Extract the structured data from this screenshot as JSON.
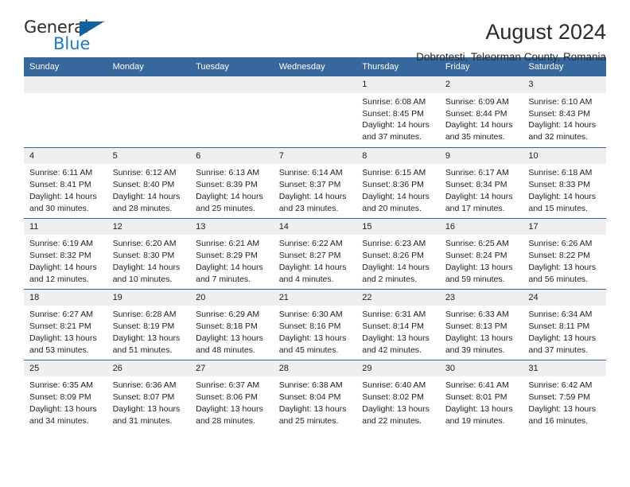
{
  "brand": {
    "name_part1": "General",
    "name_part2": "Blue",
    "triangle_color": "#12619f",
    "blue_color": "#1f7ac4"
  },
  "header": {
    "title": "August 2024",
    "subtitle": "Dobrotesti, Teleorman County, Romania"
  },
  "theme": {
    "header_bg": "#36689e",
    "daynum_bg": "#efefef",
    "text": "#222222"
  },
  "weekday_headers": [
    "Sunday",
    "Monday",
    "Tuesday",
    "Wednesday",
    "Thursday",
    "Friday",
    "Saturday"
  ],
  "weeks": [
    [
      {
        "day": "",
        "sunrise": "",
        "sunset": "",
        "daylight_line1": "",
        "daylight_line2": ""
      },
      {
        "day": "",
        "sunrise": "",
        "sunset": "",
        "daylight_line1": "",
        "daylight_line2": ""
      },
      {
        "day": "",
        "sunrise": "",
        "sunset": "",
        "daylight_line1": "",
        "daylight_line2": ""
      },
      {
        "day": "",
        "sunrise": "",
        "sunset": "",
        "daylight_line1": "",
        "daylight_line2": ""
      },
      {
        "day": "1",
        "sunrise": "Sunrise: 6:08 AM",
        "sunset": "Sunset: 8:45 PM",
        "daylight_line1": "Daylight: 14 hours",
        "daylight_line2": "and 37 minutes."
      },
      {
        "day": "2",
        "sunrise": "Sunrise: 6:09 AM",
        "sunset": "Sunset: 8:44 PM",
        "daylight_line1": "Daylight: 14 hours",
        "daylight_line2": "and 35 minutes."
      },
      {
        "day": "3",
        "sunrise": "Sunrise: 6:10 AM",
        "sunset": "Sunset: 8:43 PM",
        "daylight_line1": "Daylight: 14 hours",
        "daylight_line2": "and 32 minutes."
      }
    ],
    [
      {
        "day": "4",
        "sunrise": "Sunrise: 6:11 AM",
        "sunset": "Sunset: 8:41 PM",
        "daylight_line1": "Daylight: 14 hours",
        "daylight_line2": "and 30 minutes."
      },
      {
        "day": "5",
        "sunrise": "Sunrise: 6:12 AM",
        "sunset": "Sunset: 8:40 PM",
        "daylight_line1": "Daylight: 14 hours",
        "daylight_line2": "and 28 minutes."
      },
      {
        "day": "6",
        "sunrise": "Sunrise: 6:13 AM",
        "sunset": "Sunset: 8:39 PM",
        "daylight_line1": "Daylight: 14 hours",
        "daylight_line2": "and 25 minutes."
      },
      {
        "day": "7",
        "sunrise": "Sunrise: 6:14 AM",
        "sunset": "Sunset: 8:37 PM",
        "daylight_line1": "Daylight: 14 hours",
        "daylight_line2": "and 23 minutes."
      },
      {
        "day": "8",
        "sunrise": "Sunrise: 6:15 AM",
        "sunset": "Sunset: 8:36 PM",
        "daylight_line1": "Daylight: 14 hours",
        "daylight_line2": "and 20 minutes."
      },
      {
        "day": "9",
        "sunrise": "Sunrise: 6:17 AM",
        "sunset": "Sunset: 8:34 PM",
        "daylight_line1": "Daylight: 14 hours",
        "daylight_line2": "and 17 minutes."
      },
      {
        "day": "10",
        "sunrise": "Sunrise: 6:18 AM",
        "sunset": "Sunset: 8:33 PM",
        "daylight_line1": "Daylight: 14 hours",
        "daylight_line2": "and 15 minutes."
      }
    ],
    [
      {
        "day": "11",
        "sunrise": "Sunrise: 6:19 AM",
        "sunset": "Sunset: 8:32 PM",
        "daylight_line1": "Daylight: 14 hours",
        "daylight_line2": "and 12 minutes."
      },
      {
        "day": "12",
        "sunrise": "Sunrise: 6:20 AM",
        "sunset": "Sunset: 8:30 PM",
        "daylight_line1": "Daylight: 14 hours",
        "daylight_line2": "and 10 minutes."
      },
      {
        "day": "13",
        "sunrise": "Sunrise: 6:21 AM",
        "sunset": "Sunset: 8:29 PM",
        "daylight_line1": "Daylight: 14 hours",
        "daylight_line2": "and 7 minutes."
      },
      {
        "day": "14",
        "sunrise": "Sunrise: 6:22 AM",
        "sunset": "Sunset: 8:27 PM",
        "daylight_line1": "Daylight: 14 hours",
        "daylight_line2": "and 4 minutes."
      },
      {
        "day": "15",
        "sunrise": "Sunrise: 6:23 AM",
        "sunset": "Sunset: 8:26 PM",
        "daylight_line1": "Daylight: 14 hours",
        "daylight_line2": "and 2 minutes."
      },
      {
        "day": "16",
        "sunrise": "Sunrise: 6:25 AM",
        "sunset": "Sunset: 8:24 PM",
        "daylight_line1": "Daylight: 13 hours",
        "daylight_line2": "and 59 minutes."
      },
      {
        "day": "17",
        "sunrise": "Sunrise: 6:26 AM",
        "sunset": "Sunset: 8:22 PM",
        "daylight_line1": "Daylight: 13 hours",
        "daylight_line2": "and 56 minutes."
      }
    ],
    [
      {
        "day": "18",
        "sunrise": "Sunrise: 6:27 AM",
        "sunset": "Sunset: 8:21 PM",
        "daylight_line1": "Daylight: 13 hours",
        "daylight_line2": "and 53 minutes."
      },
      {
        "day": "19",
        "sunrise": "Sunrise: 6:28 AM",
        "sunset": "Sunset: 8:19 PM",
        "daylight_line1": "Daylight: 13 hours",
        "daylight_line2": "and 51 minutes."
      },
      {
        "day": "20",
        "sunrise": "Sunrise: 6:29 AM",
        "sunset": "Sunset: 8:18 PM",
        "daylight_line1": "Daylight: 13 hours",
        "daylight_line2": "and 48 minutes."
      },
      {
        "day": "21",
        "sunrise": "Sunrise: 6:30 AM",
        "sunset": "Sunset: 8:16 PM",
        "daylight_line1": "Daylight: 13 hours",
        "daylight_line2": "and 45 minutes."
      },
      {
        "day": "22",
        "sunrise": "Sunrise: 6:31 AM",
        "sunset": "Sunset: 8:14 PM",
        "daylight_line1": "Daylight: 13 hours",
        "daylight_line2": "and 42 minutes."
      },
      {
        "day": "23",
        "sunrise": "Sunrise: 6:33 AM",
        "sunset": "Sunset: 8:13 PM",
        "daylight_line1": "Daylight: 13 hours",
        "daylight_line2": "and 39 minutes."
      },
      {
        "day": "24",
        "sunrise": "Sunrise: 6:34 AM",
        "sunset": "Sunset: 8:11 PM",
        "daylight_line1": "Daylight: 13 hours",
        "daylight_line2": "and 37 minutes."
      }
    ],
    [
      {
        "day": "25",
        "sunrise": "Sunrise: 6:35 AM",
        "sunset": "Sunset: 8:09 PM",
        "daylight_line1": "Daylight: 13 hours",
        "daylight_line2": "and 34 minutes."
      },
      {
        "day": "26",
        "sunrise": "Sunrise: 6:36 AM",
        "sunset": "Sunset: 8:07 PM",
        "daylight_line1": "Daylight: 13 hours",
        "daylight_line2": "and 31 minutes."
      },
      {
        "day": "27",
        "sunrise": "Sunrise: 6:37 AM",
        "sunset": "Sunset: 8:06 PM",
        "daylight_line1": "Daylight: 13 hours",
        "daylight_line2": "and 28 minutes."
      },
      {
        "day": "28",
        "sunrise": "Sunrise: 6:38 AM",
        "sunset": "Sunset: 8:04 PM",
        "daylight_line1": "Daylight: 13 hours",
        "daylight_line2": "and 25 minutes."
      },
      {
        "day": "29",
        "sunrise": "Sunrise: 6:40 AM",
        "sunset": "Sunset: 8:02 PM",
        "daylight_line1": "Daylight: 13 hours",
        "daylight_line2": "and 22 minutes."
      },
      {
        "day": "30",
        "sunrise": "Sunrise: 6:41 AM",
        "sunset": "Sunset: 8:01 PM",
        "daylight_line1": "Daylight: 13 hours",
        "daylight_line2": "and 19 minutes."
      },
      {
        "day": "31",
        "sunrise": "Sunrise: 6:42 AM",
        "sunset": "Sunset: 7:59 PM",
        "daylight_line1": "Daylight: 13 hours",
        "daylight_line2": "and 16 minutes."
      }
    ]
  ]
}
